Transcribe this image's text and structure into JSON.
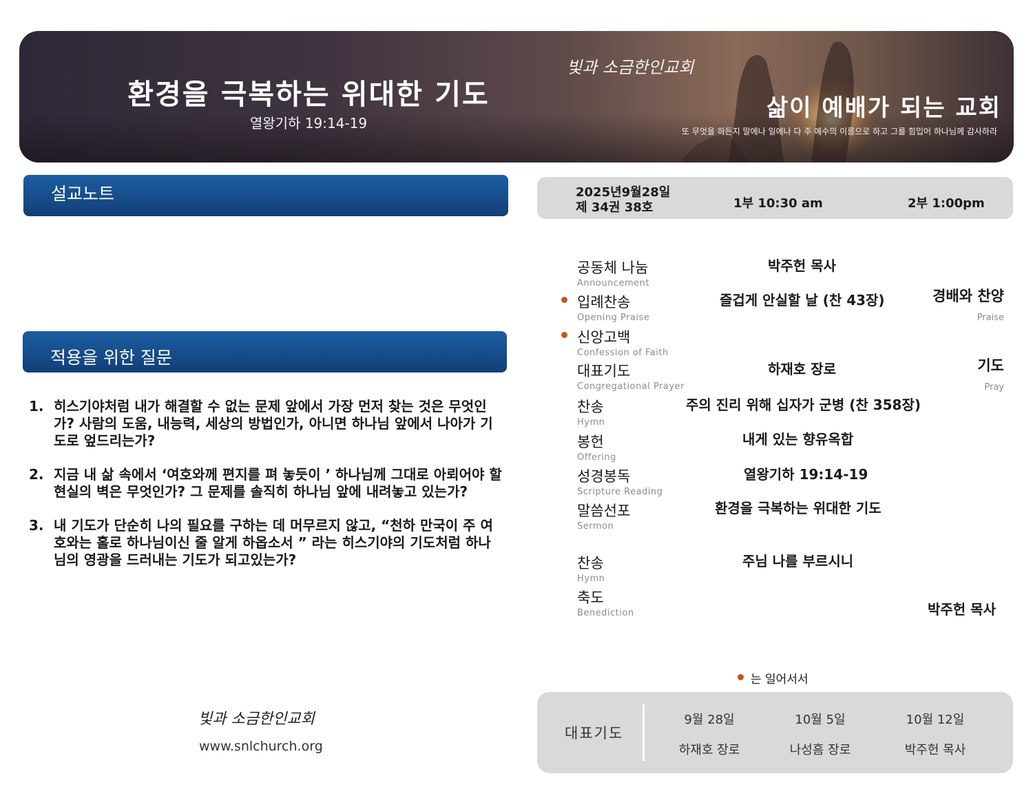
{
  "banner": {
    "title": "환경을 극복하는 위대한 기도",
    "reference": "열왕기하 19:14-19",
    "logo": "빛과 소금한인교회",
    "slogan": "삶이 예배가 되는 교회",
    "verse": "또 무엇을 하든지 말에나 일에나 다 주 예수의 이름으로 하고 그를 힘입어 하나님께 감사하라"
  },
  "sections": {
    "notes": "설교노트",
    "questions": "적용을 위한 질문"
  },
  "questions": [
    {
      "num": "1.",
      "text": "히스기야처럼 내가 해결할 수 없는 문제 앞에서 가장 먼저 찾는 것은 무엇인가? 사람의 도움, 내능력, 세상의 방법인가, 아니면 하나님 앞에서 나아가 기도로 엎드리는가?"
    },
    {
      "num": "2.",
      "text": "지금 내 삶 속에서 ‘여호와께 편지를 펴 놓듯이 ’ 하나님께 그대로 아뢰어야 할 현실의 벽은 무엇인가? 그 문제를 솔직히 하나님 앞에 내려놓고 있는가?"
    },
    {
      "num": "3.",
      "text": "내 기도가 단순히 나의 필요를 구하는 데 머무르지 않고, “천하 만국이 주 여호와는 홀로 하나님이신 줄 알게 하옵소서 ” 라는 히스기야의 기도처럼 하나님의 영광을 드러내는 기도가 되고있는가?"
    }
  ],
  "footer": {
    "logo": "빛과 소금한인교회",
    "url": "www.snlchurch.org"
  },
  "service_info": {
    "date": "2025년9월28일",
    "volume": "제 34권 38호",
    "service1": "1부 10:30 am",
    "service2": "2부 1:00pm"
  },
  "order": [
    {
      "ko": "공동체 나눔",
      "en": "Announcement",
      "detail": "박주헌 목사"
    },
    {
      "ko": "입례찬송",
      "en": "Opening Praise",
      "detail": "즐겁게 안실할 날 (찬 43장)"
    },
    {
      "ko": "신앙고백",
      "en": "Confession of Faith",
      "detail": ""
    },
    {
      "ko": "대표기도",
      "en": "Congregational Prayer",
      "detail": "하재호 장로"
    },
    {
      "ko": "찬송",
      "en": "Hymn",
      "detail": "주의 진리 위해 십자가 군병 (찬 358장)"
    },
    {
      "ko": "봉헌",
      "en": "Offering",
      "detail": "내게 있는 향유옥합"
    },
    {
      "ko": "성경봉독",
      "en": "Scripture Reading",
      "detail": "열왕기하 19:14-19"
    },
    {
      "ko": "말씀선포",
      "en": "Sermon",
      "detail": "환경을 극복하는 위대한 기도"
    },
    {
      "ko": "찬송",
      "en": "Hymn",
      "detail": "주님 나를 부르시니"
    },
    {
      "ko": "축도",
      "en": "Benediction",
      "detail": "박주헌 목사"
    }
  ],
  "order_right": {
    "praise_ko": "경배와 찬양",
    "praise_en": "Praise",
    "pray_ko": "기도",
    "pray_en": "Pray"
  },
  "stand_note": "는 일어서서",
  "prayer_schedule": {
    "label": "대표기도",
    "entries": [
      {
        "date": "9월 28일",
        "name": "하재호 장로"
      },
      {
        "date": "10월 5일",
        "name": "나성흠 장로"
      },
      {
        "date": "10월 12일",
        "name": "박주헌 목사"
      }
    ]
  },
  "colors": {
    "section_bar": "#1b5ea2",
    "bullet": "#c0581e",
    "gray_panel": "#d9d9d9"
  }
}
